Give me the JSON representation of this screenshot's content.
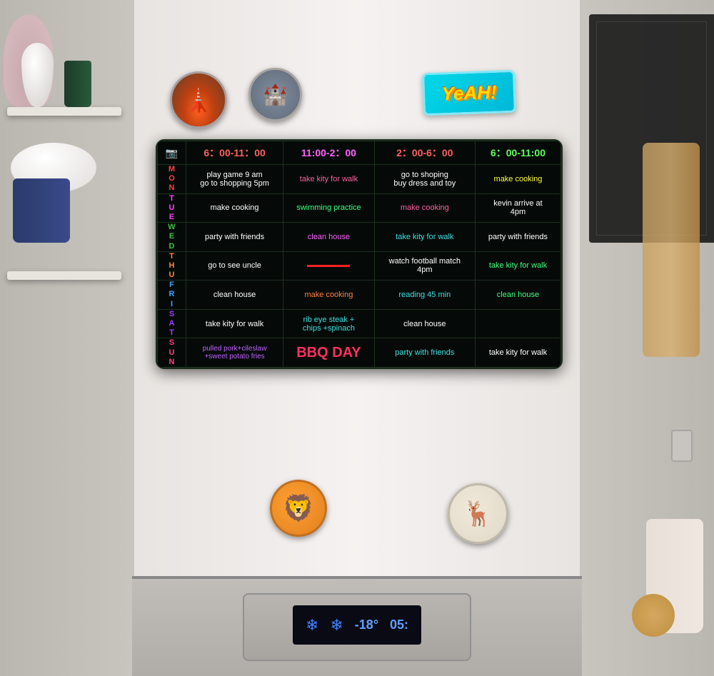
{
  "background": {
    "color": "#d8d5d0"
  },
  "magnets": {
    "yeah_label": "YeAH!",
    "paris_emoji": "🗼",
    "castle_emoji": "🏰",
    "lion_emoji": "🦁",
    "moose_emoji": "🦌"
  },
  "schedule": {
    "header": {
      "time1": "6：00-11：00",
      "time2": "11:00-2：00",
      "time3": "2：00-6：00",
      "time4": "6：00-11:00"
    },
    "rows": [
      {
        "day": "M\nO\nN",
        "day_class": "day-mon",
        "col1": "play game 9 am\ngo to shopping 5pm",
        "col1_class": "text-white",
        "col2": "take kity for walk",
        "col2_class": "text-pink",
        "col3": "go to shoping\nbuy dress and toy",
        "col3_class": "text-white",
        "col4": "make cooking",
        "col4_class": "text-yellow"
      },
      {
        "day": "T\nU\nE",
        "day_class": "day-tue",
        "col1": "make cooking",
        "col1_class": "text-white",
        "col2": "swimming practice",
        "col2_class": "text-green",
        "col3": "make cooking",
        "col3_class": "text-pink",
        "col4": "kevin arrive at\n4pm",
        "col4_class": "text-white"
      },
      {
        "day": "W\nE\nD",
        "day_class": "day-wed",
        "col1": "party with friends",
        "col1_class": "text-white",
        "col2": "clean house",
        "col2_class": "text-magenta",
        "col3": "take kity for walk",
        "col3_class": "text-cyan",
        "col4": "party with friends",
        "col4_class": "text-white"
      },
      {
        "day": "T\nH\nU",
        "day_class": "day-thu",
        "col1": "go to see uncle",
        "col1_class": "text-white",
        "col2": "",
        "col2_class": "text-red",
        "col2_line": true,
        "col3": "watch football match\n4pm",
        "col3_class": "text-white",
        "col4": "take kity for walk",
        "col4_class": "text-green"
      },
      {
        "day": "F\nR\nI",
        "day_class": "day-fri",
        "col1": "clean house",
        "col1_class": "text-white",
        "col2": "make cooking",
        "col2_class": "text-orange",
        "col3": "reading 45 min",
        "col3_class": "text-cyan",
        "col4": "clean house",
        "col4_class": "text-green"
      },
      {
        "day": "S\nA\nT",
        "day_class": "day-sat",
        "col1": "take kity for walk",
        "col1_class": "text-white",
        "col2": "rib eye steak +\nchips +spinach",
        "col2_class": "text-cyan",
        "col3": "clean house",
        "col3_class": "text-white",
        "col4": "",
        "col4_class": "text-white"
      },
      {
        "day": "S\nU\nN",
        "day_class": "day-sun",
        "col1": "pulled pork+cileslaw\n+sweet potato fries",
        "col1_class": "text-purple",
        "col2": "BBQ DAY",
        "col2_class": "text-red bbq-text",
        "col3": "party with friends",
        "col3_class": "text-cyan",
        "col4": "take kity for walk",
        "col4_class": "text-white"
      }
    ]
  },
  "fridge_display": {
    "snowflake1": "❄",
    "snowflake2": "❄",
    "temp": "-18°",
    "time": "05:"
  }
}
